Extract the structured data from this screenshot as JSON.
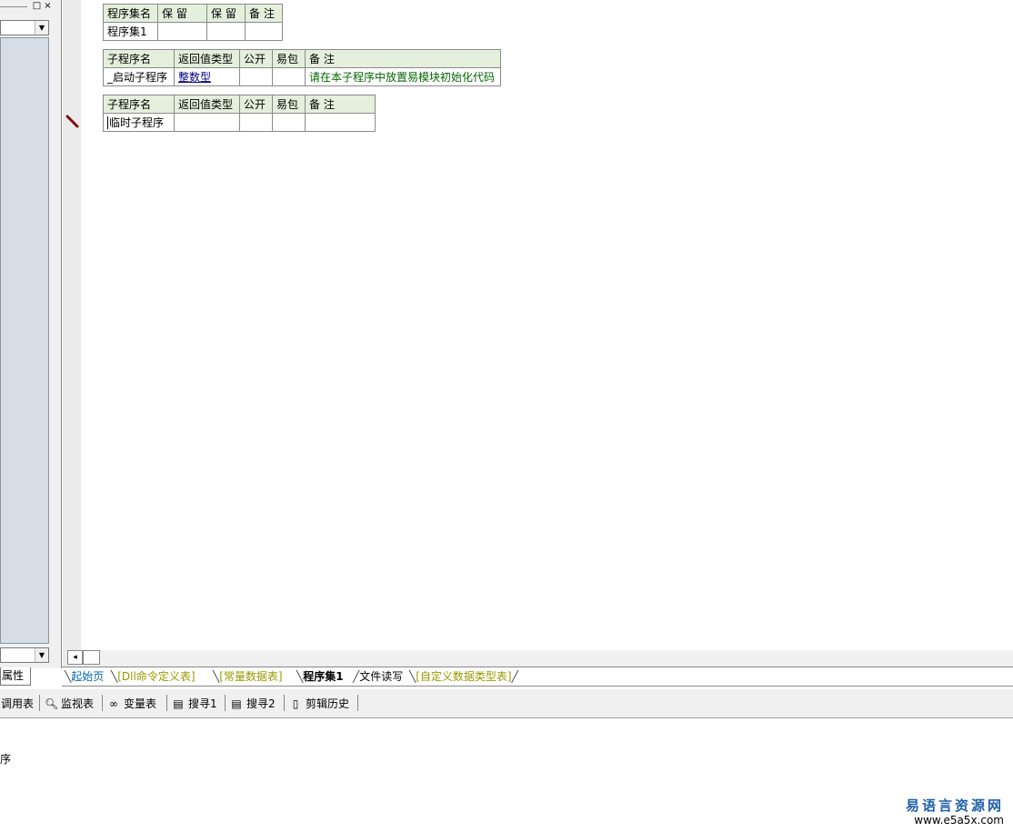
{
  "left_panel": {
    "restore_symbol": "□",
    "close_symbol": "×",
    "dropdown_arrow": "▼",
    "tab_label": "属性"
  },
  "assembly_table": {
    "headers": [
      "程序集名",
      "保 留",
      "保 留",
      "备 注"
    ],
    "row": [
      "程序集1",
      "",
      "",
      ""
    ]
  },
  "sub1_table": {
    "expand_symbol": "+",
    "headers": [
      "子程序名",
      "返回值类型",
      "公开",
      "易包",
      "备 注"
    ],
    "row": [
      "_启动子程序",
      "整数型",
      "",
      "",
      "请在本子程序中放置易模块初始化代码"
    ]
  },
  "sub2_table": {
    "expand_symbol": "+",
    "headers": [
      "子程序名",
      "返回值类型",
      "公开",
      "易包",
      "备 注"
    ],
    "row": [
      "临时子程序",
      "",
      "",
      "",
      ""
    ]
  },
  "scroll": {
    "left_arrow": "◂"
  },
  "file_tabs": [
    {
      "label": "起始页",
      "color": "#0066aa"
    },
    {
      "label": "[Dll命令定义表]",
      "color": "#999900"
    },
    {
      "label": "[常量数据表]",
      "color": "#999900"
    },
    {
      "label": "程序集1",
      "color": "#000000",
      "active": true
    },
    {
      "label": "文件读写",
      "color": "#000000"
    },
    {
      "label": "[自定义数据类型表]",
      "color": "#999900"
    }
  ],
  "tools": [
    {
      "label": "调用表",
      "icon": ""
    },
    {
      "label": "监视表",
      "icon": "magnifier-icon"
    },
    {
      "label": "变量表",
      "icon": "glasses-icon"
    },
    {
      "label": "搜寻1",
      "icon": "find-icon"
    },
    {
      "label": "搜寻2",
      "icon": "find-icon"
    },
    {
      "label": "剪辑历史",
      "icon": "clipboard-icon"
    }
  ],
  "output": {
    "text": "序"
  },
  "watermark": {
    "name": "易语言资源网",
    "url": "www.e5a5x.com"
  }
}
